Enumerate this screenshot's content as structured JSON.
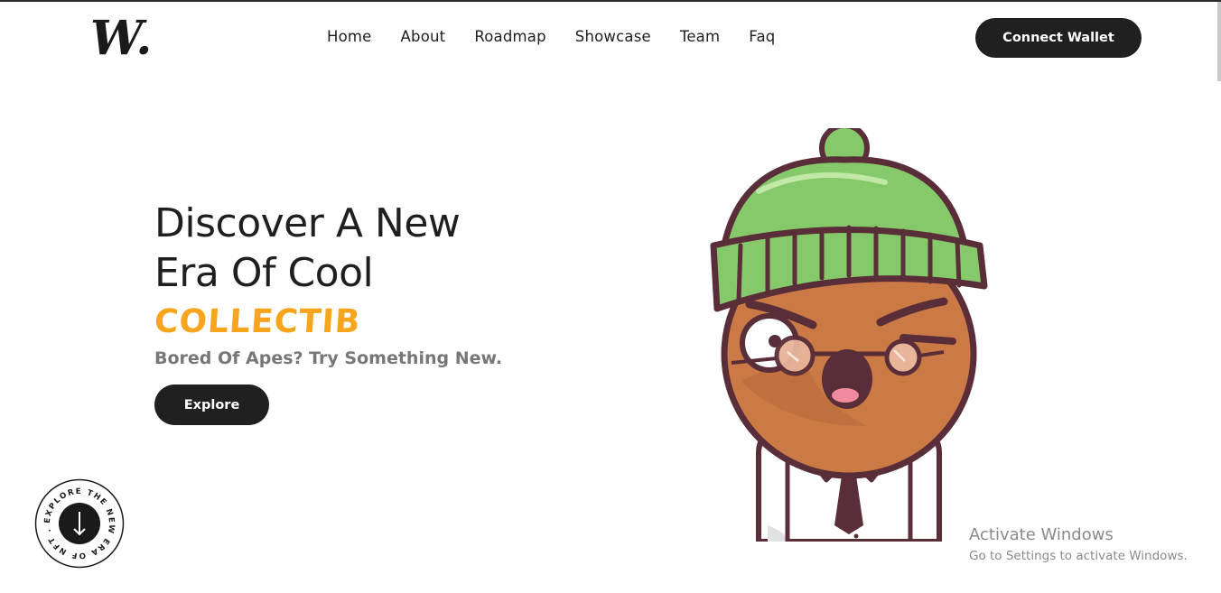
{
  "header": {
    "logo_text": "W.",
    "nav": [
      "Home",
      "About",
      "Roadmap",
      "Showcase",
      "Team",
      "Faq"
    ],
    "connect_label": "Connect Wallet"
  },
  "hero": {
    "title_line1": "Discover A New",
    "title_line2": "Era Of Cool",
    "highlight": "COLLECTIB",
    "subtitle": "Bored Of Apes? Try Something New.",
    "explore_label": "Explore"
  },
  "badge": {
    "ring_text": "EXPLORE THE NEW ERA OF NFT . "
  },
  "watermark": {
    "title": "Activate Windows",
    "subtitle": "Go to Settings to activate Windows."
  },
  "colors": {
    "accent": "#f7a51c",
    "dark": "#202020",
    "hat_green": "#86c96a",
    "skin": "#cc7a45",
    "outline": "#5a2e38"
  },
  "icons": {
    "logo": "w-logo-icon",
    "arrow": "arrow-down-icon",
    "character": "nft-character-illustration"
  }
}
